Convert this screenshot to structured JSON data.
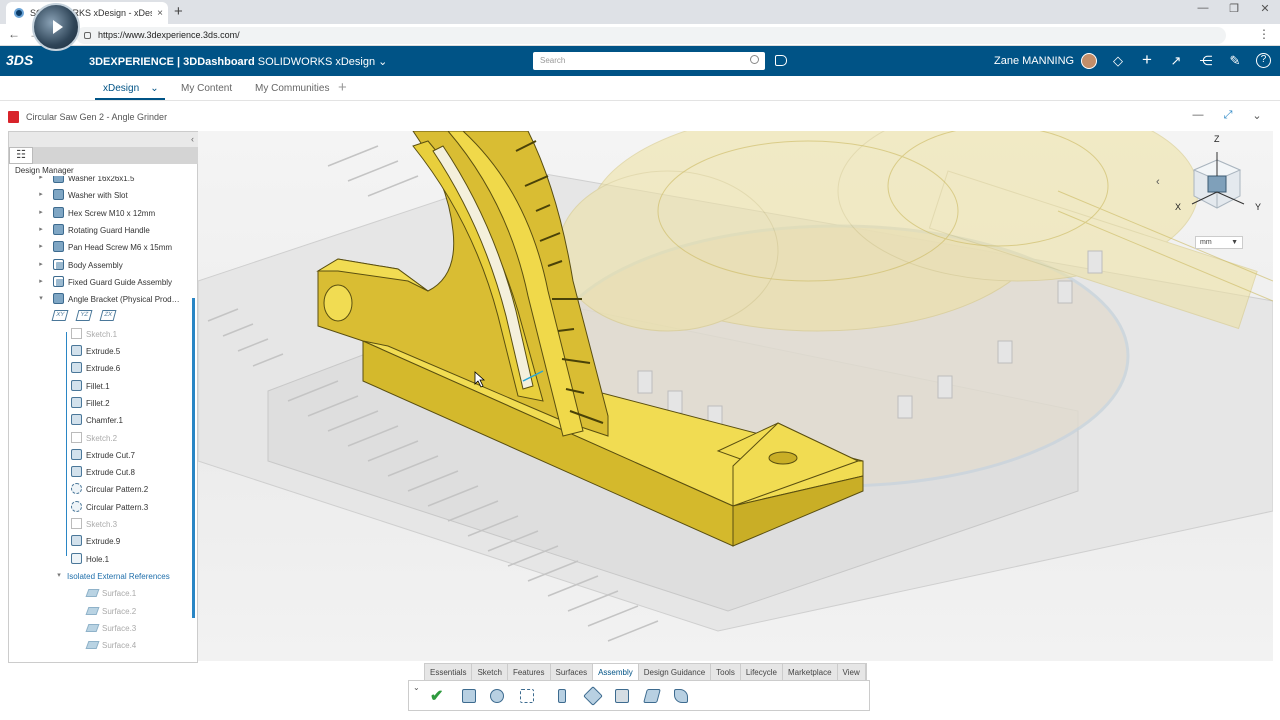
{
  "browser": {
    "tab_title": "SOLIDWORKS xDesign - xDesign",
    "tab_close": "×",
    "new_tab": "+",
    "url": "https://www.3dexperience.3ds.com/",
    "back": "←",
    "forward": "→",
    "reload": "⟳",
    "menu": "⋮",
    "minimize": "—",
    "restore": "❐",
    "close": "✕"
  },
  "topbar": {
    "ds_logo": "3DS",
    "brand_bold": "3DEXPERIENCE | 3DDashboard",
    "brand_app": " SOLIDWORKS xDesign",
    "brand_caret": "⌄",
    "search_placeholder": "Search",
    "user_name": "Zane MANNING",
    "icons": [
      "tag-icon",
      "notification-icon",
      "add-icon",
      "share-icon",
      "social-icon",
      "tools-icon",
      "help-icon"
    ],
    "plus": "+",
    "help": "?"
  },
  "app_tabs": {
    "xdesign": "xDesign",
    "xdesign_caret": "⌄",
    "my_content": "My Content",
    "my_communities": "My Communities",
    "add": "+"
  },
  "document": {
    "title": "Circular Saw Gen 2 - Angle Grinder",
    "minimize": "—",
    "fullscreen": "⤢",
    "more": "⌄"
  },
  "design_manager": {
    "title": "Design Manager",
    "collapse": "‹",
    "tab_icon": "☷",
    "items": [
      {
        "label": "Washer 16x26x1.5",
        "type": "part",
        "level": 0,
        "expander": "▸"
      },
      {
        "label": "Washer with Slot",
        "type": "part",
        "level": 0,
        "expander": "▸"
      },
      {
        "label": "Hex Screw M10 x 12mm",
        "type": "part",
        "level": 0,
        "expander": "▸"
      },
      {
        "label": "Rotating Guard Handle",
        "type": "part",
        "level": 0,
        "expander": "▸"
      },
      {
        "label": "Pan Head Screw M6 x 15mm",
        "type": "part",
        "level": 0,
        "expander": "▸"
      },
      {
        "label": "Body Assembly",
        "type": "asm",
        "level": 0,
        "expander": "▸"
      },
      {
        "label": "Fixed Guard Guide Assembly",
        "type": "asm",
        "level": 0,
        "expander": "▸"
      },
      {
        "label": "Angle Bracket (Physical Prod…",
        "type": "part",
        "level": 0,
        "expander": "▾"
      },
      {
        "label": "",
        "type": "planes",
        "level": 1,
        "planes": [
          "XY",
          "YZ",
          "ZX"
        ]
      },
      {
        "label": "Sketch.1",
        "type": "sketch",
        "level": 1,
        "dim": true
      },
      {
        "label": "Extrude.5",
        "type": "feat",
        "level": 1
      },
      {
        "label": "Extrude.6",
        "type": "feat",
        "level": 1
      },
      {
        "label": "Fillet.1",
        "type": "feat",
        "level": 1
      },
      {
        "label": "Fillet.2",
        "type": "feat",
        "level": 1
      },
      {
        "label": "Chamfer.1",
        "type": "feat",
        "level": 1
      },
      {
        "label": "Sketch.2",
        "type": "sketch",
        "level": 1,
        "dim": true
      },
      {
        "label": "Extrude Cut.7",
        "type": "feat",
        "level": 1
      },
      {
        "label": "Extrude Cut.8",
        "type": "feat",
        "level": 1
      },
      {
        "label": "Circular Pattern.2",
        "type": "pattern",
        "level": 1
      },
      {
        "label": "Circular Pattern.3",
        "type": "pattern",
        "level": 1
      },
      {
        "label": "Sketch.3",
        "type": "sketch",
        "level": 1,
        "dim": true
      },
      {
        "label": "Extrude.9",
        "type": "feat",
        "level": 1
      },
      {
        "label": "Hole.1",
        "type": "hole",
        "level": 1
      },
      {
        "label": "Isolated External References",
        "type": "folder",
        "level": 1,
        "blue": true,
        "expander": "▾"
      },
      {
        "label": "Surface.1",
        "type": "surf",
        "level": 2,
        "dim": true
      },
      {
        "label": "Surface.2",
        "type": "surf",
        "level": 2,
        "dim": true
      },
      {
        "label": "Surface.3",
        "type": "surf",
        "level": 2,
        "dim": true
      },
      {
        "label": "Surface.4",
        "type": "surf",
        "level": 2,
        "dim": true
      }
    ]
  },
  "view_cube": {
    "z": "Z",
    "x": "X",
    "y": "Y",
    "back": "‹",
    "units": "mm",
    "units_caret": "▼"
  },
  "action_bar": {
    "toggle": "⌄",
    "tabs": [
      "Essentials",
      "Sketch",
      "Features",
      "Surfaces",
      "Assembly",
      "Design Guidance",
      "Tools",
      "Lifecycle",
      "Marketplace",
      "View"
    ],
    "active_tab": "Assembly",
    "tools": [
      "check-icon",
      "insert-component-icon",
      "insert-part-icon",
      "pattern-icon",
      "explode-icon",
      "mate-icon",
      "interference-icon",
      "mechanism-icon",
      "motion-icon"
    ]
  },
  "colors": {
    "brand": "#005386",
    "part_yellow": "#e8cf3c",
    "accent": "#2a86c5"
  }
}
